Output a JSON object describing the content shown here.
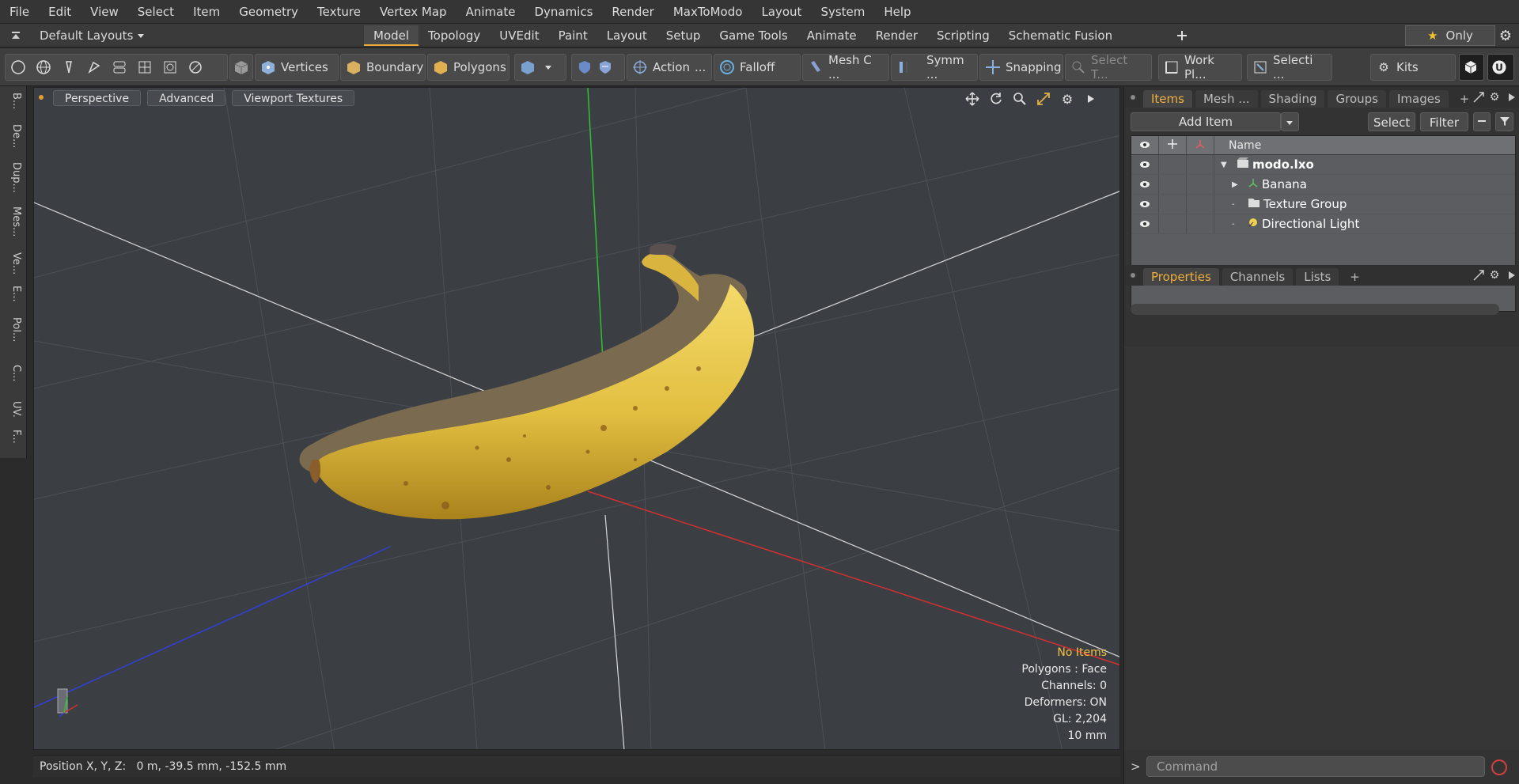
{
  "menu": [
    "File",
    "Edit",
    "View",
    "Select",
    "Item",
    "Geometry",
    "Texture",
    "Vertex Map",
    "Animate",
    "Dynamics",
    "Render",
    "MaxToModo",
    "Layout",
    "System",
    "Help"
  ],
  "layout": {
    "preset_label": "Default Layouts",
    "tabs": [
      "Model",
      "Topology",
      "UVEdit",
      "Paint",
      "Layout",
      "Setup",
      "Game Tools",
      "Animate",
      "Render",
      "Scripting",
      "Schematic Fusion"
    ],
    "active_tab": "Model",
    "only_label": "Only"
  },
  "toolbar": {
    "vertices": "Vertices",
    "boundary": "Boundary",
    "polygons": "Polygons",
    "action": "Action",
    "falloff": "Falloff",
    "mesh_c": "Mesh C ...",
    "symm": "Symm ...",
    "snapping": "Snapping",
    "select_t": "Select T...",
    "work_pl": "Work Pl...",
    "selecti": "Selecti ...",
    "kits": "Kits"
  },
  "left_tabs": [
    "B...",
    "De...",
    "Dup...",
    "Mes...",
    "Ve...",
    "E...",
    "Pol...",
    "C...",
    "UV.",
    "F..."
  ],
  "viewport": {
    "buttons": [
      "Perspective",
      "Advanced",
      "Viewport Textures"
    ],
    "hud": {
      "selection": "No Items",
      "polygons": "Polygons : Face",
      "channels": "Channels: 0",
      "deformers": "Deformers: ON",
      "gl": "GL: 2,204",
      "scale": "10 mm"
    }
  },
  "status": {
    "position": "Position X, Y, Z:   0 m, -39.5 mm, -152.5 mm"
  },
  "panel": {
    "top_tabs": [
      "Items",
      "Mesh ...",
      "Shading",
      "Groups",
      "Images"
    ],
    "active_top_tab": "Items",
    "add_item": "Add Item",
    "select": "Select",
    "filter": "Filter",
    "column_name": "Name",
    "items": [
      {
        "label": "modo.lxo"
      },
      {
        "label": "Banana"
      },
      {
        "label": "Texture Group"
      },
      {
        "label": "Directional Light"
      }
    ],
    "bottom_tabs": [
      "Properties",
      "Channels",
      "Lists"
    ],
    "active_bottom_tab": "Properties",
    "command_placeholder": "Command"
  },
  "colors": {
    "accent": "#e8a83a",
    "axis_x": "#d43030",
    "axis_y": "#30c030",
    "axis_z": "#3040d8",
    "banana": "#e3c24a"
  }
}
